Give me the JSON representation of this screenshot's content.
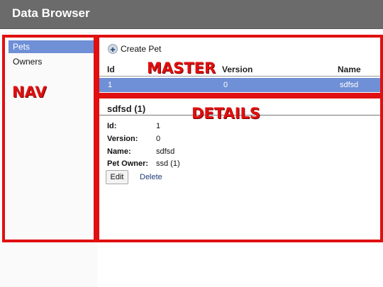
{
  "app": {
    "title": "Data Browser"
  },
  "nav": {
    "items": [
      {
        "label": "Pets",
        "selected": true
      },
      {
        "label": "Owners",
        "selected": false
      }
    ]
  },
  "master": {
    "create_label": "Create Pet",
    "columns": [
      "Id",
      "Version",
      "Name"
    ],
    "rows": [
      {
        "id": "1",
        "version": "0",
        "name": "sdfsd",
        "selected": true
      }
    ]
  },
  "details": {
    "title": "sdfsd (1)",
    "fields": [
      {
        "label": "Id:",
        "value": "1"
      },
      {
        "label": "Version:",
        "value": "0"
      },
      {
        "label": "Name:",
        "value": "sdfsd"
      },
      {
        "label": "Pet Owner:",
        "value": "ssd (1)"
      }
    ],
    "edit_label": "Edit",
    "delete_label": "Delete"
  },
  "annotations": {
    "nav": "NAV",
    "master": "MASTER",
    "details": "DETAILS",
    "color": "#e01010"
  },
  "colors": {
    "header_bg": "#6b6b6b",
    "selection": "#6f8fd6"
  }
}
